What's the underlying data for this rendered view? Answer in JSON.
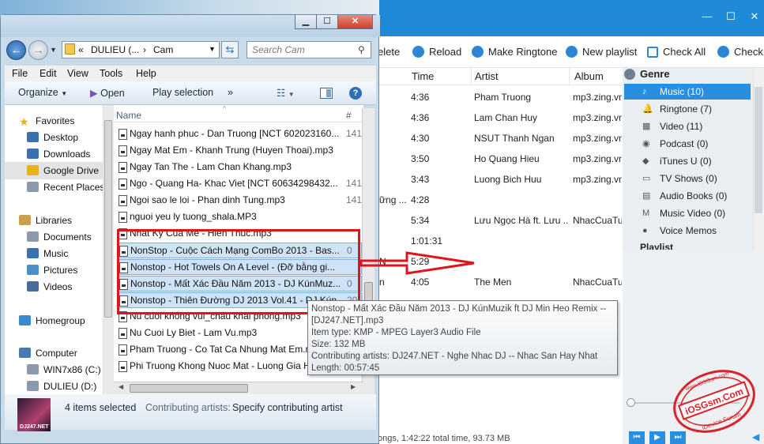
{
  "app": {
    "toolbar": [
      {
        "label": "elete",
        "icon": "delete-icon"
      },
      {
        "label": "Reload",
        "icon": "reload-icon"
      },
      {
        "label": "Make Ringtone",
        "icon": "bell-icon"
      },
      {
        "label": "New playlist",
        "icon": "playlist-icon"
      },
      {
        "label": "Check All",
        "icon": "checkbox-icon"
      },
      {
        "label": "Check :",
        "icon": "checkbox-icon"
      }
    ],
    "columns": {
      "time": "Time",
      "artist": "Artist",
      "album": "Album"
    },
    "rows": [
      {
        "prefix": "",
        "time": "4:36",
        "artist": "Pham Truong",
        "album": "mp3.zing.vn"
      },
      {
        "prefix": "",
        "time": "4:36",
        "artist": "Lam Chan Huy",
        "album": "mp3.zing.vn"
      },
      {
        "prefix": "",
        "time": "4:30",
        "artist": "NSUT Thanh Ngan",
        "album": "mp3.zing.vn"
      },
      {
        "prefix": "",
        "time": "3:50",
        "artist": "Ho Quang Hieu",
        "album": "mp3.zing.vn"
      },
      {
        "prefix": "",
        "time": "3:43",
        "artist": "Luong Bich Huu",
        "album": "mp3.zing.vn"
      },
      {
        "prefix": "ững ...",
        "time": "4:28",
        "artist": "",
        "album": ""
      },
      {
        "prefix": "",
        "time": "5:34",
        "artist": "Lưu Ngọc Hà ft. Lưu ...",
        "album": "NhacCuaTui"
      },
      {
        "prefix": "",
        "time": "1:01:31",
        "artist": "",
        "album": ""
      },
      {
        "prefix": "N",
        "time": "5:29",
        "artist": "",
        "album": ""
      },
      {
        "prefix": "n",
        "time": "4:05",
        "artist": "The Men",
        "album": "NhacCuaTui"
      }
    ],
    "genre": {
      "title": "Genre",
      "items": [
        {
          "label": "Music (10)",
          "icon": "music-note-icon",
          "selected": true
        },
        {
          "label": "Ringtone (7)",
          "icon": "bell-icon"
        },
        {
          "label": "Video (11)",
          "icon": "film-icon"
        },
        {
          "label": "Podcast (0)",
          "icon": "podcast-icon"
        },
        {
          "label": "iTunes U (0)",
          "icon": "graduation-cap-icon"
        },
        {
          "label": "TV Shows (0)",
          "icon": "tv-icon"
        },
        {
          "label": "Audio Books (0)",
          "icon": "book-icon"
        },
        {
          "label": "Music Video (0)",
          "icon": "music-video-icon"
        },
        {
          "label": "Voice Memos",
          "icon": "microphone-icon"
        }
      ],
      "cut_label": "Playlist"
    },
    "status": "ongs, 1:42:22 total time, 93.73 MB",
    "accent": "#1f8ad8"
  },
  "explorer": {
    "address": {
      "prefix": "«",
      "crumb1": "DULIEU (...",
      "sep": "›",
      "crumb2": "Cam"
    },
    "search_placeholder": "Search Cam",
    "menu": [
      "File",
      "Edit",
      "View",
      "Tools",
      "Help"
    ],
    "commands": {
      "organize": "Organize",
      "open": "Open",
      "play": "Play selection",
      "more": "»"
    },
    "nav": [
      {
        "label": "Favorites",
        "icon": "star-icon",
        "indent": 0
      },
      {
        "label": "Desktop",
        "icon": "desktop-icon",
        "indent": 1
      },
      {
        "label": "Downloads",
        "icon": "downloads-icon",
        "indent": 1
      },
      {
        "label": "Google Drive",
        "icon": "google-drive-icon",
        "indent": 1,
        "selected": true
      },
      {
        "label": "Recent Places",
        "icon": "recent-places-icon",
        "indent": 1
      },
      {
        "label": "Libraries",
        "icon": "libraries-icon",
        "indent": 0
      },
      {
        "label": "Documents",
        "icon": "documents-icon",
        "indent": 1
      },
      {
        "label": "Music",
        "icon": "music-icon",
        "indent": 1
      },
      {
        "label": "Pictures",
        "icon": "pictures-icon",
        "indent": 1
      },
      {
        "label": "Videos",
        "icon": "videos-icon",
        "indent": 1
      },
      {
        "label": "Homegroup",
        "icon": "homegroup-icon",
        "indent": 0
      },
      {
        "label": "Computer",
        "icon": "computer-icon",
        "indent": 0
      },
      {
        "label": "WIN7x86 (C:)",
        "icon": "drive-icon",
        "indent": 1
      },
      {
        "label": "DULIEU (D:)",
        "icon": "drive-icon",
        "indent": 1
      }
    ],
    "header": {
      "name": "Name",
      "num": "#"
    },
    "files": [
      {
        "name": "Ngay hanh phuc - Dan Truong [NCT 602023160...",
        "num": "141"
      },
      {
        "name": "Ngay Mat Em - Khanh Trung (Huyen Thoai).mp3",
        "num": ""
      },
      {
        "name": "Ngay Tan The - Lam Chan Khang.mp3",
        "num": ""
      },
      {
        "name": "Ngo  - Quang Ha- Khac Viet [NCT 60634298432...",
        "num": "141"
      },
      {
        "name": "Ngoi sao le loi - Phan dinh Tung.mp3",
        "num": "141"
      },
      {
        "name": "nguoi yeu ly tuong_shala.MP3",
        "num": ""
      },
      {
        "name": "Nhat Ky Cua Me - Hien Thuc.mp3",
        "num": ""
      },
      {
        "name": "NonStop - Cuộc Cách Mạng ComBo 2013 - Bas...",
        "num": "0",
        "selected": true
      },
      {
        "name": "Nonstop - Hot Towels On A Level - (Đỡ bằng gi...",
        "num": "",
        "selected": true
      },
      {
        "name": "Nonstop - Mất Xác Đầu Năm 2013 - DJ KúnMuz...",
        "num": "0",
        "selected": true
      },
      {
        "name": "Nonstop - Thiên Đường DJ 2013 Vol.41 - DJ Kún...",
        "num": "20",
        "selected": true
      },
      {
        "name": "Nu cuoi khong vui_chau khai phong.mp3",
        "num": ""
      },
      {
        "name": "Nu Cuoi Ly Biet - Lam Vu.mp3",
        "num": ""
      },
      {
        "name": "Pham Truong - Co Tat Ca Nhung Mat Em.mp3",
        "num": ""
      },
      {
        "name": "Phi Truong Khong Nuoc Mat - Luong Gia Huy...",
        "num": ""
      }
    ],
    "details": {
      "selected": "4 items selected",
      "artists_label": "Contributing artists:",
      "artists_value": "Specify contributing artist",
      "album_art_text": "DJ247.NET"
    }
  },
  "tooltip": [
    "Nonstop - Mất Xác Đầu Năm 2013 - DJ KúnMuzik ft DJ Min Heo Remix --",
    "[DJ247.NET].mp3",
    "Item type: KMP - MPEG Layer3 Audio File",
    "Size: 132 MB",
    "Contributing artists: DJ247.NET - Nghe Nhac DJ -- Nhac San Hay Nhat",
    "Length: 00:57:45"
  ],
  "watermark": {
    "top": "www.iOSGsm.com",
    "center": "iOSGsm.Com",
    "bottom": "iDevice Forum",
    "color": "#d8232a"
  }
}
